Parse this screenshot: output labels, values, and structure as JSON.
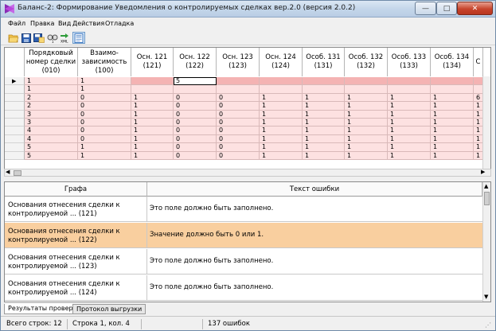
{
  "window": {
    "title": "Баланс-2: Формирование Уведомления о контролируемых сделках вер.2.0 (версия 2.0.2)",
    "min_glyph": "—",
    "max_glyph": "□",
    "close_glyph": "✕"
  },
  "menu": [
    "Файл",
    "Правка",
    "Вид",
    "Действия",
    "Отладка"
  ],
  "toolbar_icons": [
    "open-folder-icon",
    "save-icon",
    "save-as-icon",
    "find-icon",
    "upload-xml-icon",
    "document-view-icon"
  ],
  "grid": {
    "columns": [
      "Порядковый\nномер сделки\n(010)",
      "Взаимо-\nзависимость\n(100)",
      "Осн. 121\n(121)",
      "Осн. 122\n(122)",
      "Осн. 123\n(123)",
      "Осн. 124\n(124)",
      "Особ. 131\n(131)",
      "Особ. 132\n(132)",
      "Особ. 133\n(133)",
      "Особ. 134\n(134)",
      "С"
    ],
    "current_row_marker": "▶",
    "rows": [
      [
        "1",
        "1",
        "",
        "5",
        "",
        "",
        "",
        "",
        "",
        "",
        ""
      ],
      [
        "1",
        "1",
        "",
        "",
        "",
        "",
        "",
        "",
        "",
        "",
        ""
      ],
      [
        "2",
        "0",
        "1",
        "0",
        "0",
        "1",
        "1",
        "1",
        "1",
        "1",
        "6"
      ],
      [
        "2",
        "0",
        "1",
        "0",
        "0",
        "1",
        "1",
        "1",
        "1",
        "1",
        "1"
      ],
      [
        "3",
        "0",
        "1",
        "0",
        "0",
        "1",
        "1",
        "1",
        "1",
        "1",
        "1"
      ],
      [
        "3",
        "0",
        "1",
        "0",
        "0",
        "1",
        "1",
        "1",
        "1",
        "1",
        "1"
      ],
      [
        "4",
        "0",
        "1",
        "0",
        "0",
        "1",
        "1",
        "1",
        "1",
        "1",
        "1"
      ],
      [
        "4",
        "0",
        "1",
        "0",
        "0",
        "1",
        "1",
        "1",
        "1",
        "1",
        "1"
      ],
      [
        "5",
        "1",
        "1",
        "0",
        "0",
        "1",
        "1",
        "1",
        "1",
        "1",
        "1"
      ],
      [
        "5",
        "1",
        "1",
        "0",
        "0",
        "1",
        "1",
        "1",
        "1",
        "1",
        "1"
      ]
    ]
  },
  "errors": {
    "col_field": "Графа",
    "col_text": "Текст ошибки",
    "rows": [
      {
        "field": "Основания отнесения сделки к\nконтролируемой ... (121)",
        "text": "Это поле должно быть заполнено."
      },
      {
        "field": "Основания отнесения сделки к\nконтролируемой ... (122)",
        "text": "Значение должно быть 0 или 1."
      },
      {
        "field": "Основания отнесения сделки к\nконтролируемой ... (123)",
        "text": "Это поле должно быть заполнено."
      },
      {
        "field": "Основания отнесения сделки к\nконтролируемой ... (124)",
        "text": "Это поле должно быть заполнено."
      }
    ]
  },
  "tabs": [
    "Результаты проверки",
    "Протокол выгрузки"
  ],
  "status": {
    "total_rows": "Всего строк: 12",
    "position": "Строка 1, кол. 4",
    "errors_count": "137 ошибок"
  },
  "colors": {
    "invalid_row": "#f4b3b3",
    "row_tint": "#fde1e1",
    "selected_error": "#f9cf9f",
    "close_button": "#c7442c"
  }
}
